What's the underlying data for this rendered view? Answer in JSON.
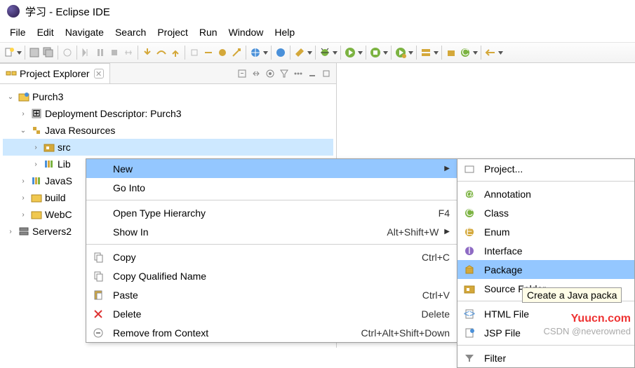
{
  "title": "学习 - Eclipse IDE",
  "menu": [
    "File",
    "Edit",
    "Navigate",
    "Search",
    "Project",
    "Run",
    "Window",
    "Help"
  ],
  "explorer": {
    "title": "Project Explorer"
  },
  "tree": {
    "proj": "Purch3",
    "dd": "Deployment Descriptor: Purch3",
    "jr": "Java Resources",
    "src": "src",
    "lib": "Lib",
    "js": "JavaS",
    "build": "build",
    "web": "WebC",
    "servers": "Servers2"
  },
  "ctx": {
    "new": "New",
    "goInto": "Go Into",
    "oth": "Open Type Hierarchy",
    "oth_k": "F4",
    "showIn": "Show In",
    "showIn_k": "Alt+Shift+W",
    "copy": "Copy",
    "copy_k": "Ctrl+C",
    "cqn": "Copy Qualified Name",
    "paste": "Paste",
    "paste_k": "Ctrl+V",
    "delete": "Delete",
    "delete_k": "Delete",
    "rfc": "Remove from Context",
    "rfc_k": "Ctrl+Alt+Shift+Down"
  },
  "sub": {
    "project": "Project...",
    "annotation": "Annotation",
    "class": "Class",
    "enum": "Enum",
    "interface": "Interface",
    "package": "Package",
    "srcfolder": "Source Folder",
    "html": "HTML File",
    "jsp": "JSP File",
    "filter": "Filter"
  },
  "tooltip": "Create a Java packa",
  "wm1": "CSDN @neverowned",
  "wm2": "Yuucn.com"
}
